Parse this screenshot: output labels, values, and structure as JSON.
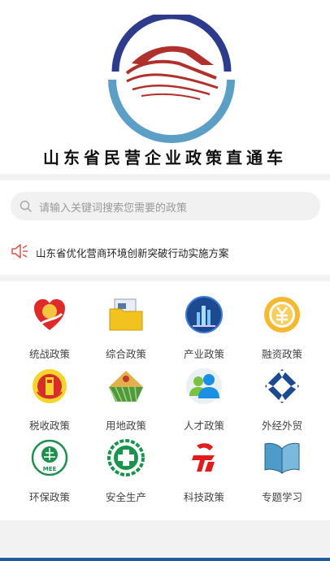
{
  "brand": {
    "title": "山东省民营企业政策直通车"
  },
  "search": {
    "placeholder": "请输入关键词搜索您需要的政策"
  },
  "notice": {
    "text": "山东省优化营商环境创新突破行动实施方案"
  },
  "grid": {
    "items": [
      {
        "label": "统战政策",
        "icon": "united-front-icon"
      },
      {
        "label": "综合政策",
        "icon": "folder-icon"
      },
      {
        "label": "产业政策",
        "icon": "industry-icon"
      },
      {
        "label": "融资政策",
        "icon": "yuan-coin-icon"
      },
      {
        "label": "税收政策",
        "icon": "tax-emblem-icon"
      },
      {
        "label": "用地政策",
        "icon": "farmland-icon"
      },
      {
        "label": "人才政策",
        "icon": "people-icon"
      },
      {
        "label": "外经外贸",
        "icon": "trade-icon"
      },
      {
        "label": "环保政策",
        "icon": "mee-emblem-icon"
      },
      {
        "label": "安全生产",
        "icon": "safety-cross-icon"
      },
      {
        "label": "科技政策",
        "icon": "science-icon"
      },
      {
        "label": "专题学习",
        "icon": "book-icon"
      }
    ]
  },
  "colors": {
    "accent_blue": "#1f5b9d",
    "logo_red": "#b0302b",
    "logo_navy": "#2d3b8c",
    "logo_teal": "#5b9ec6"
  }
}
